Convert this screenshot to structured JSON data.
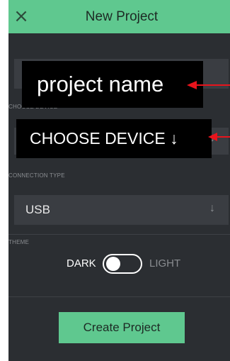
{
  "header": {
    "close_icon": "×",
    "title": "New Project"
  },
  "sections": {
    "device_label": "CHOOSE DEVICE",
    "connection_label": "CONNECTION TYPE",
    "theme_label": "THEME"
  },
  "connection": {
    "selected": "USB",
    "arrow_icon": "↓"
  },
  "device": {
    "arrow_icon": "↓"
  },
  "theme": {
    "dark_label": "DARK",
    "light_label": "LIGHT",
    "state": "dark"
  },
  "create_button_label": "Create Project",
  "annotations": {
    "project_name": "project name",
    "choose_device": "CHOOSE  DEVICE ↓",
    "arrow_color": "#e8141c"
  },
  "colors": {
    "accent": "#5fc88f",
    "background": "#2b2e32",
    "field": "#3a3d42"
  }
}
